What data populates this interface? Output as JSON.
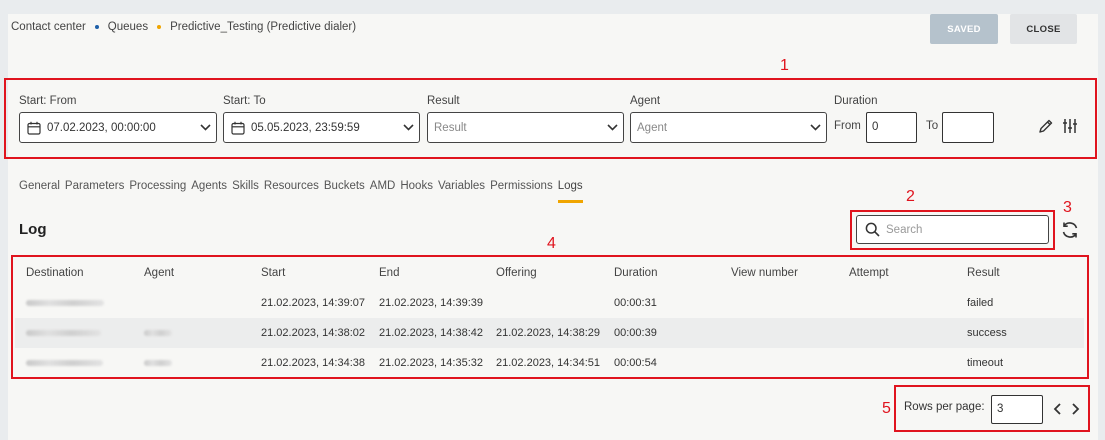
{
  "breadcrumb": {
    "item1": "Contact center",
    "item2": "Queues",
    "item3": "Predictive_Testing (Predictive dialer)"
  },
  "header": {
    "saved_label": "SAVED",
    "close_label": "CLOSE"
  },
  "filters": {
    "start_from": {
      "label": "Start: From",
      "value": "07.02.2023, 00:00:00"
    },
    "start_to": {
      "label": "Start: To",
      "value": "05.05.2023, 23:59:59"
    },
    "result": {
      "label": "Result",
      "placeholder": "Result"
    },
    "agent": {
      "label": "Agent",
      "placeholder": "Agent"
    },
    "duration": {
      "label": "Duration",
      "from_label": "From",
      "from_value": "0",
      "to_label": "To",
      "to_value": ""
    }
  },
  "tabs": [
    "General",
    "Parameters",
    "Processing",
    "Agents",
    "Skills",
    "Resources",
    "Buckets",
    "AMD",
    "Hooks",
    "Variables",
    "Permissions",
    "Logs"
  ],
  "active_tab": "Logs",
  "log": {
    "title": "Log",
    "search_placeholder": "Search",
    "columns": [
      "Destination",
      "Agent",
      "Start",
      "End",
      "Offering",
      "Duration",
      "View number",
      "Attempt",
      "Result"
    ],
    "rows": [
      {
        "start": "21.02.2023, 14:39:07",
        "end": "21.02.2023, 14:39:39",
        "offering": "",
        "duration": "00:00:31",
        "result": "failed"
      },
      {
        "start": "21.02.2023, 14:38:02",
        "end": "21.02.2023, 14:38:42",
        "offering": "21.02.2023, 14:38:29",
        "duration": "00:00:39",
        "result": "success"
      },
      {
        "start": "21.02.2023, 14:34:38",
        "end": "21.02.2023, 14:35:32",
        "offering": "21.02.2023, 14:34:51",
        "duration": "00:00:54",
        "result": "timeout"
      }
    ]
  },
  "pagination": {
    "rows_per_page_label": "Rows per page:",
    "rows_per_page_value": "3"
  },
  "annotations": [
    "1",
    "2",
    "3",
    "4",
    "5"
  ],
  "colors": {
    "accent": "#f0a500",
    "annotation": "#e0141e",
    "saved_button": "#b5c2cc",
    "breadcrumb_dot": "#1e5fa8"
  },
  "icons": [
    "calendar-icon",
    "chevron-down-icon",
    "pencil-icon",
    "column-settings-icon",
    "search-icon",
    "refresh-icon",
    "chevron-left-icon",
    "chevron-right-icon"
  ]
}
